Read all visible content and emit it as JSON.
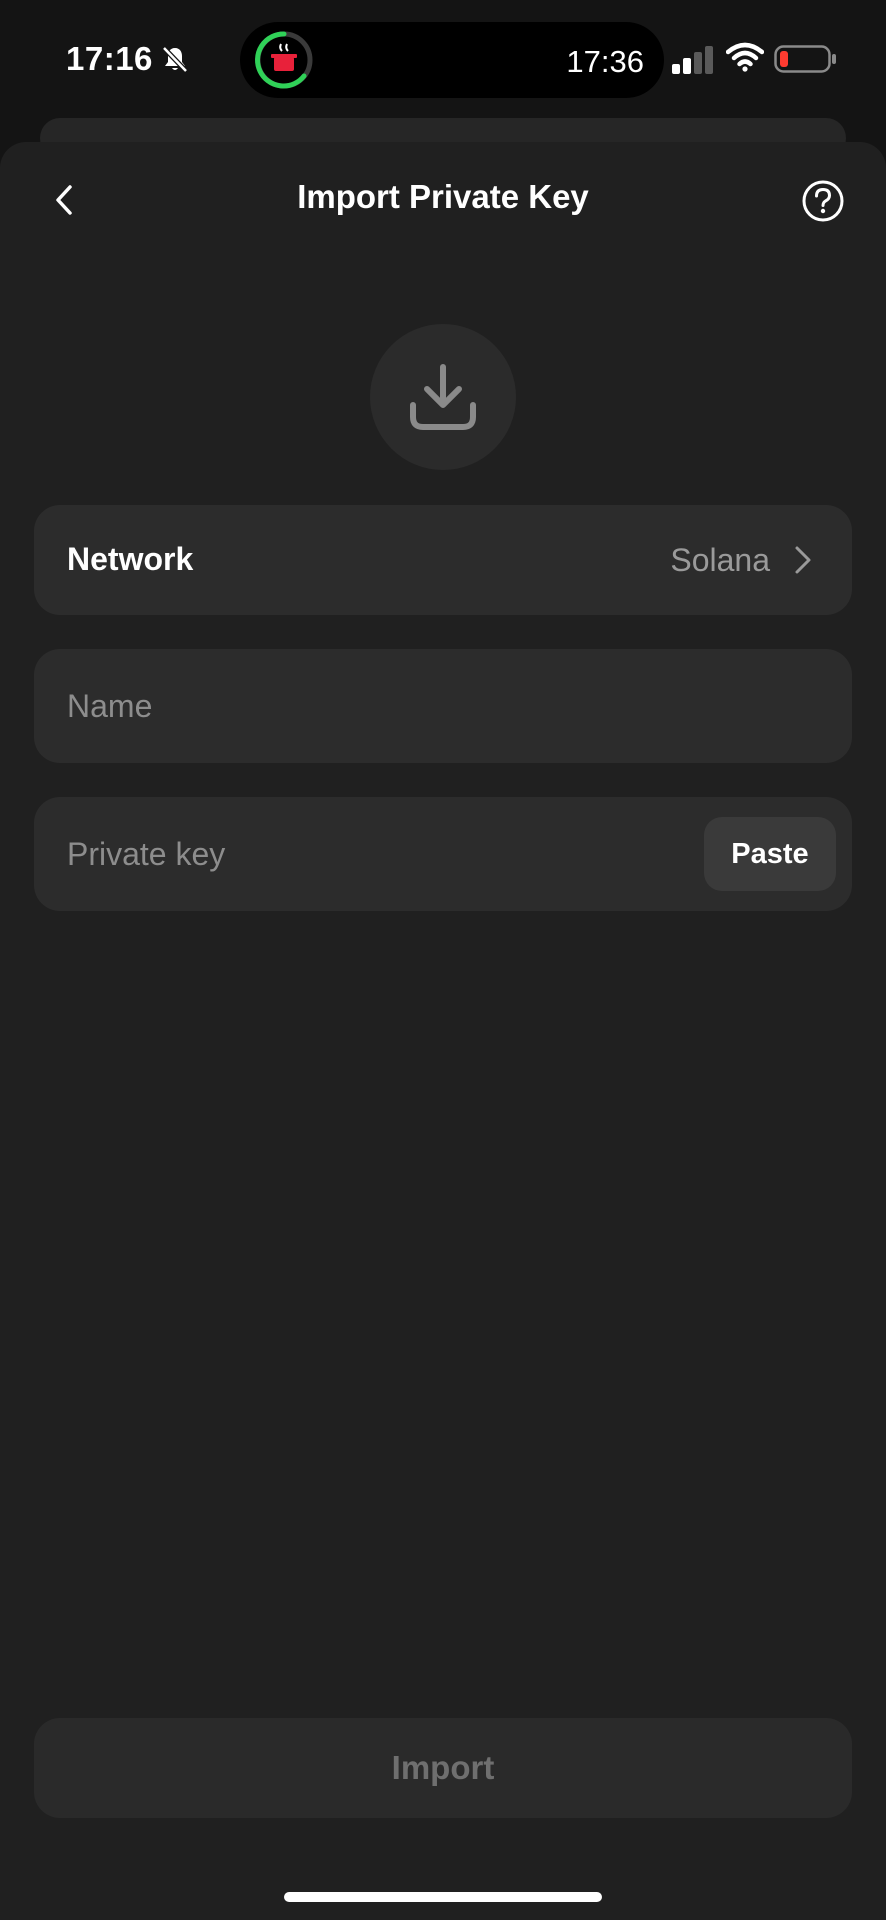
{
  "status_bar": {
    "time": "17:16",
    "island_time": "17:36",
    "icons": [
      "bell-slash-icon",
      "cooking-pot-app-icon",
      "signal-icon",
      "wifi-icon",
      "battery-low-icon"
    ],
    "battery_color": "#ff3b30",
    "activity_ring_color": "#30d158"
  },
  "header": {
    "title": "Import Private Key",
    "back_icon": "chevron-left-icon",
    "help_icon": "question-circle-icon"
  },
  "hero": {
    "icon": "download-icon"
  },
  "network": {
    "label": "Network",
    "value": "Solana",
    "icon": "chevron-right-icon"
  },
  "name_field": {
    "placeholder": "Name",
    "value": ""
  },
  "private_key_field": {
    "placeholder": "Private key",
    "value": "",
    "paste_label": "Paste"
  },
  "footer": {
    "import_label": "Import"
  },
  "colors": {
    "background": "#202020",
    "card": "#2c2c2c",
    "muted_text": "#9a9a9a",
    "disabled_button_text": "#6f6f6f"
  }
}
